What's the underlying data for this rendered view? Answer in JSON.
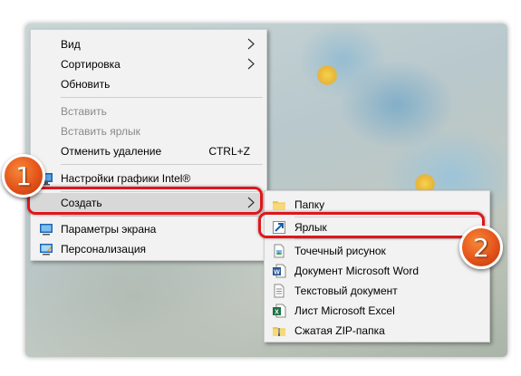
{
  "main_menu": {
    "items": [
      {
        "label": "Вид"
      },
      {
        "label": "Сортировка"
      },
      {
        "label": "Обновить"
      },
      {
        "label": "Вставить"
      },
      {
        "label": "Вставить ярлык"
      },
      {
        "label": "Отменить удаление",
        "shortcut": "CTRL+Z"
      },
      {
        "label": "Настройки графики Intel®"
      },
      {
        "label": "Создать"
      },
      {
        "label": "Параметры экрана"
      },
      {
        "label": "Персонализация"
      }
    ]
  },
  "sub_menu": {
    "items": [
      {
        "label": "Папку",
        "icon": "folder-icon"
      },
      {
        "label": "Ярлык",
        "icon": "shortcut-icon"
      },
      {
        "label": "Точечный рисунок",
        "icon": "bitmap-image-icon"
      },
      {
        "label": "Документ Microsoft Word",
        "icon": "word-document-icon"
      },
      {
        "label": "Текстовый документ",
        "icon": "text-document-icon"
      },
      {
        "label": "Лист Microsoft Excel",
        "icon": "excel-sheet-icon"
      },
      {
        "label": "Сжатая ZIP-папка",
        "icon": "zip-folder-icon"
      }
    ]
  },
  "annotations": {
    "step1": "1",
    "step2": "2"
  },
  "colors": {
    "annotation_red": "#e0161b",
    "badge_orange": "#e4541a",
    "menu_background": "#f2f2f2"
  }
}
